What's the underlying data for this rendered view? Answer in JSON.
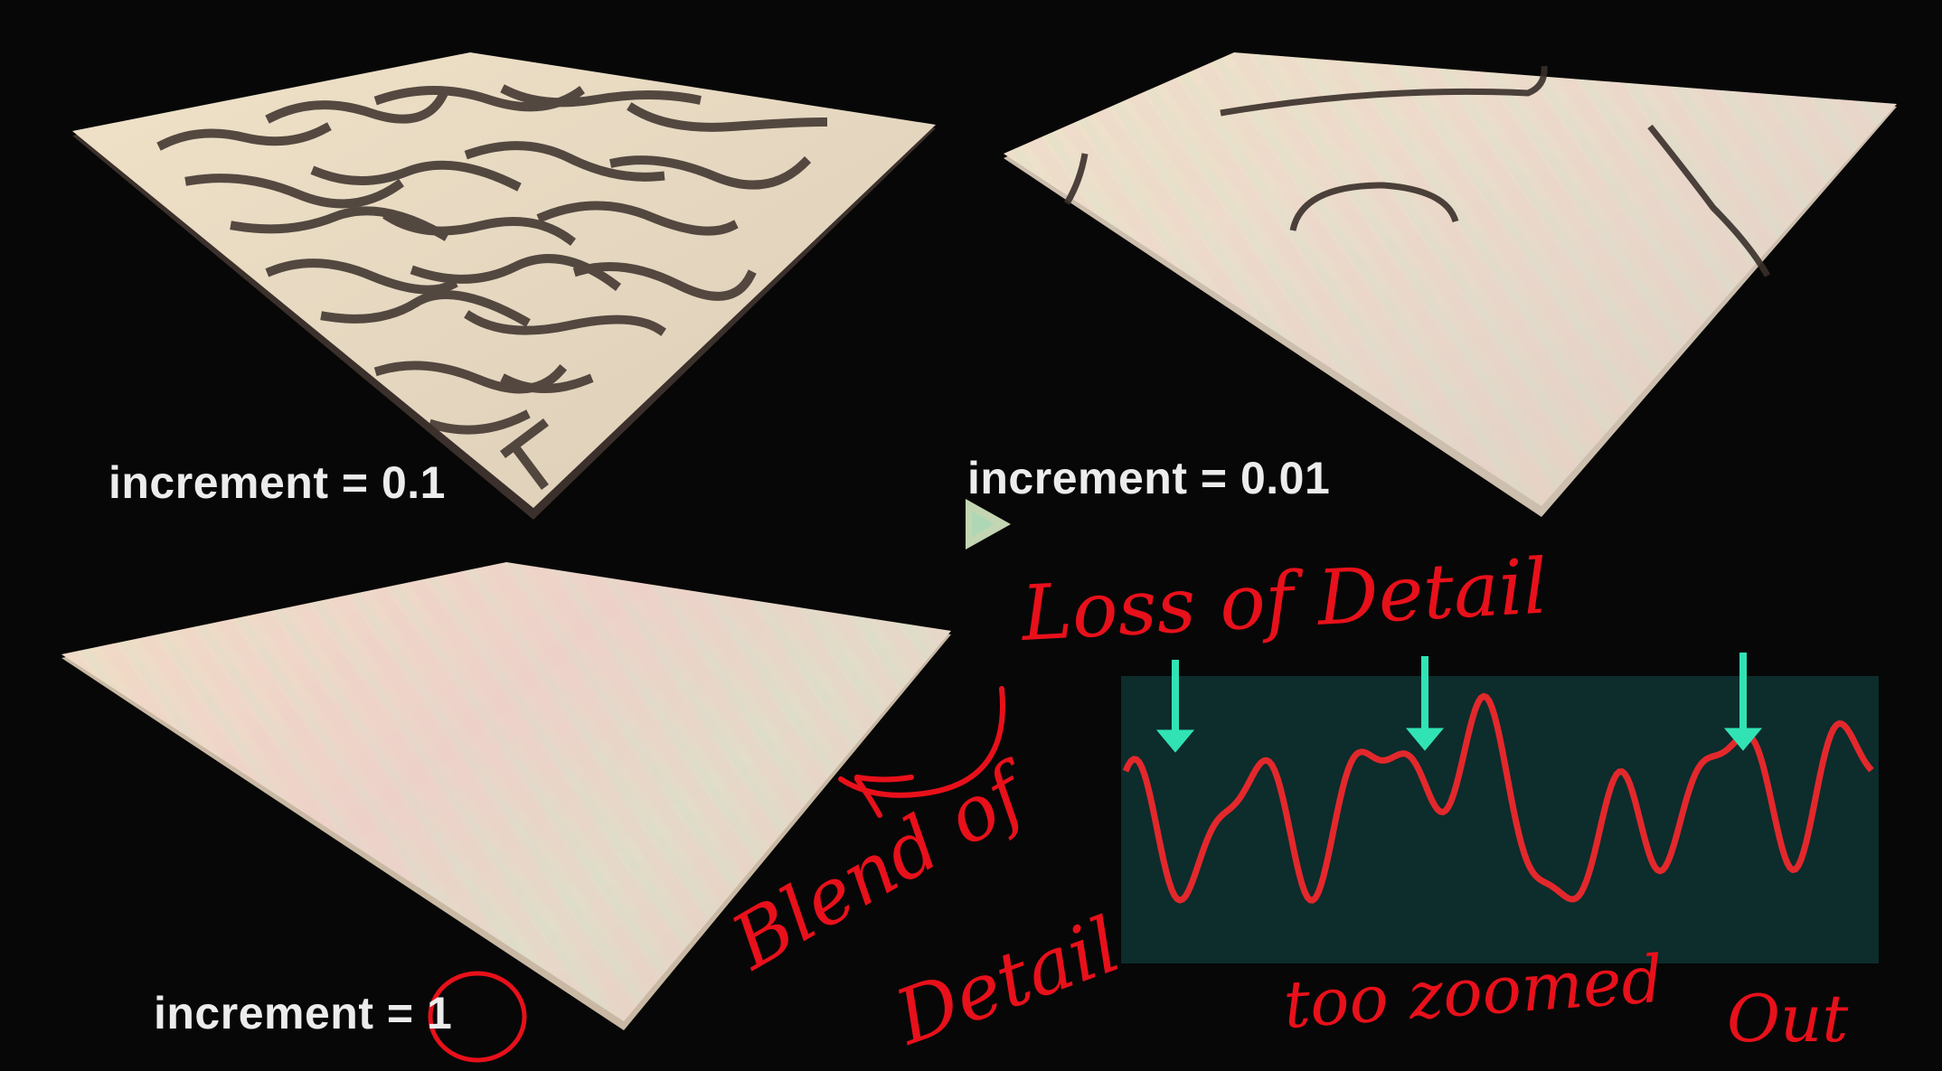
{
  "slide": {
    "panels": [
      {
        "id": "increment-0-1",
        "label": "increment = 0.1"
      },
      {
        "id": "increment-0-01",
        "label": "increment = 0.01"
      },
      {
        "id": "increment-1",
        "label": "increment = 1"
      }
    ],
    "colors": {
      "background": "#070707",
      "terrain": "#e9dcc3",
      "terrain_shadow": "#3b302b",
      "wave_panel": "#0d2c2c",
      "wave_line": "#e3282c",
      "arrow": "#31e3b4",
      "annotation_ink": "#e8101a"
    }
  },
  "annotations": {
    "loss_of_detail": "Loss of Detail",
    "blend_of": "Blend of",
    "detail": "Detail",
    "too_zoomed": "too zoomed",
    "out": "Out"
  },
  "icons": [
    "play-icon",
    "down-arrow-icon",
    "curved-arrow-icon",
    "circle-highlight-icon"
  ]
}
